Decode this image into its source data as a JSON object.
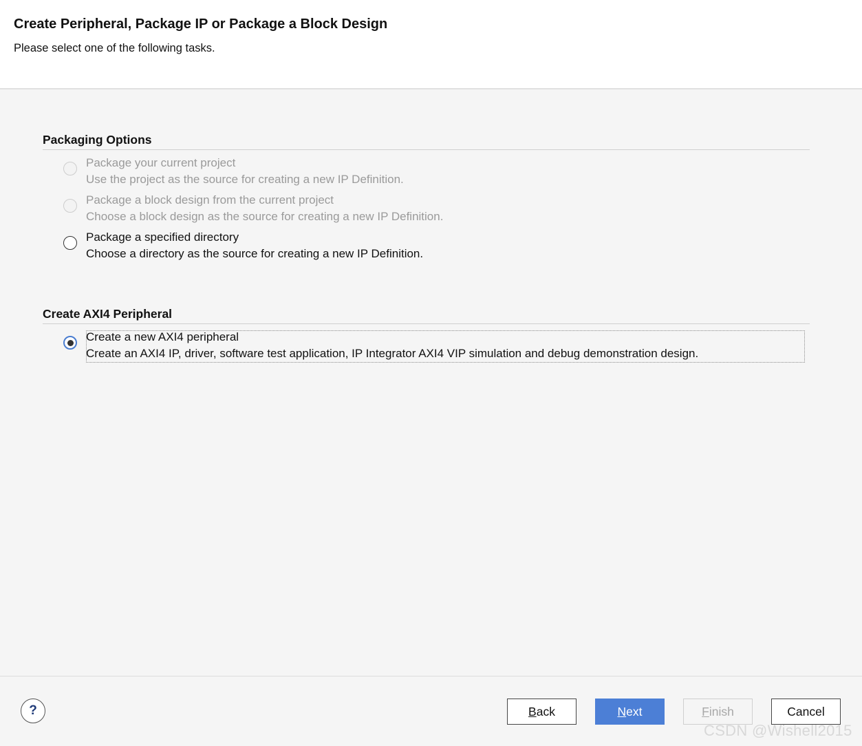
{
  "header": {
    "title": "Create Peripheral, Package IP or Package a Block Design",
    "subtitle": "Please select one of the following tasks."
  },
  "packaging": {
    "title": "Packaging Options",
    "options": [
      {
        "label": "Package your current project",
        "description": "Use the project as the source for creating a new IP Definition.",
        "state": "disabled"
      },
      {
        "label": "Package a block design from the current project",
        "description": "Choose a block design as the source for creating a new IP Definition.",
        "state": "disabled"
      },
      {
        "label": "Package a specified directory",
        "description": "Choose a directory as the source for creating a new IP Definition.",
        "state": "enabled"
      }
    ]
  },
  "axi4": {
    "title": "Create AXI4 Peripheral",
    "option": {
      "label": "Create a new AXI4 peripheral",
      "description": "Create an AXI4 IP, driver, software test application, IP Integrator AXI4 VIP simulation and debug demonstration design.",
      "state": "selected"
    }
  },
  "footer": {
    "help_label": "?",
    "back": {
      "mnemonic": "B",
      "rest": "ack"
    },
    "next": {
      "mnemonic": "N",
      "rest": "ext"
    },
    "finish": {
      "mnemonic": "F",
      "rest": "inish"
    },
    "cancel_label": "Cancel"
  },
  "watermark": "CSDN @Wishell2015",
  "colors": {
    "accent": "#4c7fd6",
    "selected_radio": "#4a7dd0",
    "disabled_text": "#9a9a9a",
    "background": "#f5f5f5"
  }
}
